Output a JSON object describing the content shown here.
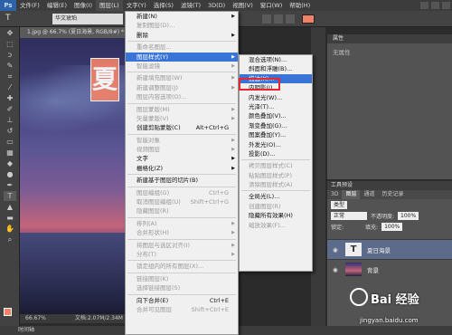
{
  "app": {
    "logo": "Ps"
  },
  "menubar": [
    "文件(F)",
    "编辑(E)",
    "图像(I)",
    "图层(L)",
    "文字(Y)",
    "选择(S)",
    "滤镜(T)",
    "3D(D)",
    "视图(V)",
    "窗口(W)",
    "帮助(H)"
  ],
  "options": {
    "font": "华文琥珀",
    "color": "#f0826a"
  },
  "document": {
    "tab": "1.jpg @ 66.7% (夏日海景, RGB/8#) *",
    "canvas_text": "夏",
    "zoom": "66.67%",
    "doc_info": "文档:2.07M/2.34M"
  },
  "bottom": {
    "label": "时间轴"
  },
  "properties": {
    "title": "属性",
    "empty": "无属性"
  },
  "layers": {
    "header": "工具预设",
    "tabs": [
      "3D",
      "图层",
      "通道",
      "历史记录"
    ],
    "kind_label": "类型",
    "blend": "正常",
    "opacity_label": "不透明度:",
    "opacity": "100%",
    "lock_label": "锁定:",
    "fill_label": "填充:",
    "fill": "100%",
    "items": [
      {
        "name": "夏日海景",
        "thumb": "T"
      },
      {
        "name": "背景",
        "thumb": ""
      }
    ]
  },
  "main_menu": [
    {
      "label": "新建(N)",
      "arrow": true
    },
    {
      "label": "复制图层(D)...",
      "disabled": true
    },
    {
      "label": "删除",
      "arrow": true
    },
    {
      "sep": true
    },
    {
      "label": "重命名图层...",
      "disabled": true
    },
    {
      "label": "图层样式(Y)",
      "arrow": true,
      "highlight": true
    },
    {
      "label": "智能滤镜",
      "arrow": true,
      "disabled": true
    },
    {
      "sep": true
    },
    {
      "label": "新建填充图层(W)",
      "arrow": true,
      "disabled": true
    },
    {
      "label": "新建调整图层(J)",
      "arrow": true,
      "disabled": true
    },
    {
      "label": "图层内容选项(O)...",
      "disabled": true
    },
    {
      "sep": true
    },
    {
      "label": "图层蒙版(M)",
      "arrow": true,
      "disabled": true
    },
    {
      "label": "矢量蒙版(V)",
      "arrow": true,
      "disabled": true
    },
    {
      "label": "创建剪贴蒙版(C)",
      "shortcut": "Alt+Ctrl+G"
    },
    {
      "sep": true
    },
    {
      "label": "智能对象",
      "arrow": true,
      "disabled": true
    },
    {
      "label": "视频图层",
      "arrow": true,
      "disabled": true
    },
    {
      "label": "文字",
      "arrow": true
    },
    {
      "label": "栅格化(Z)",
      "arrow": true
    },
    {
      "sep": true
    },
    {
      "label": "新建基于图层的切片(B)"
    },
    {
      "sep": true
    },
    {
      "label": "图层编组(G)",
      "shortcut": "Ctrl+G",
      "disabled": true
    },
    {
      "label": "取消图层编组(U)",
      "shortcut": "Shift+Ctrl+G",
      "disabled": true
    },
    {
      "label": "隐藏图层(R)",
      "disabled": true
    },
    {
      "sep": true
    },
    {
      "label": "排列(A)",
      "arrow": true,
      "disabled": true
    },
    {
      "label": "合并形状(H)",
      "arrow": true,
      "disabled": true
    },
    {
      "sep": true
    },
    {
      "label": "将图层与选区对齐(I)",
      "arrow": true,
      "disabled": true
    },
    {
      "label": "分布(T)",
      "arrow": true,
      "disabled": true
    },
    {
      "sep": true
    },
    {
      "label": "锁定组内的所有图层(X)...",
      "disabled": true
    },
    {
      "sep": true
    },
    {
      "label": "链接图层(K)",
      "disabled": true
    },
    {
      "label": "选择链接图层(S)",
      "disabled": true
    },
    {
      "sep": true
    },
    {
      "label": "向下合并(E)",
      "shortcut": "Ctrl+E"
    },
    {
      "label": "合并可见图层",
      "shortcut": "Shift+Ctrl+E",
      "disabled": true
    }
  ],
  "sub_menu": [
    {
      "label": "混合选项(N)..."
    },
    {
      "label": "斜面和浮雕(B)..."
    },
    {
      "label": "描边(K)...",
      "highlight": true
    },
    {
      "label": "内阴影(I)..."
    },
    {
      "label": "内发光(W)..."
    },
    {
      "label": "光泽(T)..."
    },
    {
      "label": "颜色叠加(V)..."
    },
    {
      "label": "渐变叠加(G)..."
    },
    {
      "label": "图案叠加(Y)..."
    },
    {
      "label": "外发光(O)..."
    },
    {
      "label": "投影(D)..."
    },
    {
      "sep": true
    },
    {
      "label": "拷贝图层样式(C)",
      "disabled": true
    },
    {
      "label": "粘贴图层样式(P)",
      "disabled": true
    },
    {
      "label": "清除图层样式(A)",
      "disabled": true
    },
    {
      "sep": true
    },
    {
      "label": "全局光(L)..."
    },
    {
      "label": "创建图层(R)",
      "disabled": true
    },
    {
      "label": "隐藏所有效果(H)"
    },
    {
      "label": "缩放效果(F)...",
      "disabled": true
    }
  ],
  "watermark": {
    "brand": "Bai 经验",
    "url": "jingyan.baidu.com"
  }
}
